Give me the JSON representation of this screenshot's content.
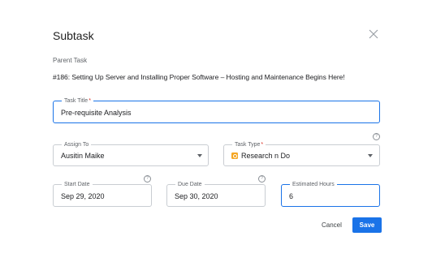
{
  "dialog": {
    "title": "Subtask",
    "close_icon": "close-icon"
  },
  "parent_task": {
    "label": "Parent Task",
    "value": "#186: Setting Up Server and Installing Proper Software – Hosting and Maintenance Begins Here!"
  },
  "task_title": {
    "label": "Task Title",
    "required": "*",
    "value": "Pre-requisite Analysis"
  },
  "assign_to": {
    "label": "Assign To",
    "value": "Ausitin Maike"
  },
  "task_type": {
    "label": "Task Type",
    "required": "*",
    "value": "Research n Do",
    "icon": "task-type-icon"
  },
  "start_date": {
    "label": "Start Date",
    "value": "Sep 29, 2020"
  },
  "due_date": {
    "label": "Due Date",
    "value": "Sep 30, 2020"
  },
  "estimated_hours": {
    "label": "Estimated Hours",
    "value": "6"
  },
  "help_icon_glyph": "?",
  "actions": {
    "cancel": "Cancel",
    "save": "Save"
  },
  "colors": {
    "primary": "#1a73e8",
    "required": "#d93025",
    "task_type_icon": "#f5a623"
  }
}
